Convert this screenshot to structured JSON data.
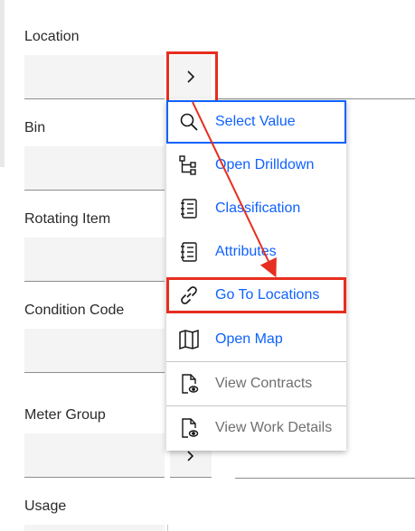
{
  "fields": {
    "location": {
      "label": "Location",
      "value": ""
    },
    "bin": {
      "label": "Bin",
      "value": ""
    },
    "rotating_item": {
      "label": "Rotating Item",
      "value": ""
    },
    "condition_code": {
      "label": "Condition Code",
      "value": ""
    },
    "meter_group": {
      "label": "Meter Group",
      "value": ""
    },
    "usage": {
      "label": "Usage",
      "value": ""
    }
  },
  "menu": {
    "items": [
      {
        "label": "Select Value",
        "icon": "search-icon",
        "state": "focused"
      },
      {
        "label": "Open Drilldown",
        "icon": "tree-view-icon",
        "state": "enabled"
      },
      {
        "label": "Classification",
        "icon": "list-document-icon",
        "state": "enabled"
      },
      {
        "label": "Attributes",
        "icon": "list-document-icon",
        "state": "enabled"
      },
      {
        "label": "Go To Locations",
        "icon": "link-icon",
        "state": "highlighted"
      },
      {
        "label": "Open Map",
        "icon": "map-icon",
        "state": "enabled"
      },
      {
        "label": "View Contracts",
        "icon": "document-view-icon",
        "state": "disabled"
      },
      {
        "label": "View Work Details",
        "icon": "document-view-icon",
        "state": "disabled"
      }
    ]
  },
  "colors": {
    "link_blue": "#0f62fe",
    "annotation_red": "#e62e1f",
    "disabled_gray": "#6f6f6f",
    "field_bg": "#f4f4f4"
  }
}
